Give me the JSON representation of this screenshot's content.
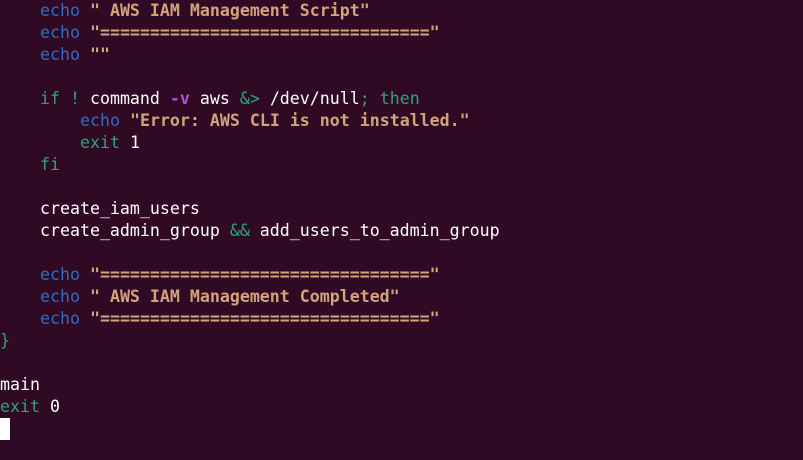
{
  "terminal": {
    "lines": [
      {
        "tokens": [
          {
            "t": "echo",
            "c": "echo"
          },
          {
            "t": " ",
            "c": "plain"
          },
          {
            "t": "\" AWS IAM Management Script\"",
            "c": "str"
          }
        ]
      },
      {
        "tokens": [
          {
            "t": "echo",
            "c": "echo"
          },
          {
            "t": " ",
            "c": "plain"
          },
          {
            "t": "\"=================================\"",
            "c": "str"
          }
        ]
      },
      {
        "tokens": [
          {
            "t": "echo",
            "c": "echo"
          },
          {
            "t": " ",
            "c": "plain"
          },
          {
            "t": "\"\"",
            "c": "str"
          }
        ]
      },
      {
        "tokens": [
          {
            "t": "if",
            "c": "kw"
          },
          {
            "t": " ",
            "c": "plain"
          },
          {
            "t": "!",
            "c": "kw"
          },
          {
            "t": " command ",
            "c": "plain"
          },
          {
            "t": "-v",
            "c": "flag"
          },
          {
            "t": " aws ",
            "c": "plain"
          },
          {
            "t": "&>",
            "c": "op"
          },
          {
            "t": " /dev/null",
            "c": "plain"
          },
          {
            "t": ";",
            "c": "op"
          },
          {
            "t": " ",
            "c": "plain"
          },
          {
            "t": "then",
            "c": "kw"
          }
        ]
      },
      {
        "tokens": [
          {
            "t": "echo",
            "c": "echo"
          },
          {
            "t": " ",
            "c": "plain"
          },
          {
            "t": "\"Error: AWS CLI is not installed.\"",
            "c": "str"
          }
        ]
      },
      {
        "tokens": [
          {
            "t": "exit",
            "c": "kw"
          },
          {
            "t": " 1",
            "c": "plain"
          }
        ]
      },
      {
        "tokens": [
          {
            "t": "fi",
            "c": "kw"
          }
        ]
      },
      {
        "tokens": [
          {
            "t": "create_iam_users",
            "c": "plain"
          }
        ]
      },
      {
        "tokens": [
          {
            "t": "create_admin_group ",
            "c": "plain"
          },
          {
            "t": "&&",
            "c": "op"
          },
          {
            "t": " add_users_to_admin_group",
            "c": "plain"
          }
        ]
      },
      {
        "tokens": [
          {
            "t": "echo",
            "c": "echo"
          },
          {
            "t": " ",
            "c": "plain"
          },
          {
            "t": "\"=================================\"",
            "c": "str"
          }
        ]
      },
      {
        "tokens": [
          {
            "t": "echo",
            "c": "echo"
          },
          {
            "t": " ",
            "c": "plain"
          },
          {
            "t": "\" AWS IAM Management Completed\"",
            "c": "str"
          }
        ]
      },
      {
        "tokens": [
          {
            "t": "echo",
            "c": "echo"
          },
          {
            "t": " ",
            "c": "plain"
          },
          {
            "t": "\"=================================\"",
            "c": "str"
          }
        ]
      },
      {
        "tokens": [
          {
            "t": "}",
            "c": "kw"
          }
        ]
      },
      {
        "tokens": [
          {
            "t": "main",
            "c": "plain"
          }
        ]
      },
      {
        "tokens": [
          {
            "t": "exit",
            "c": "kw"
          },
          {
            "t": " 0",
            "c": "plain"
          }
        ]
      }
    ]
  },
  "colors": {
    "background": "#300a24",
    "echo": "#2a6fc4",
    "string": "#d3a37a",
    "keyword": "#2fa37a",
    "flag": "#b04fd4",
    "text": "#ffffff"
  }
}
